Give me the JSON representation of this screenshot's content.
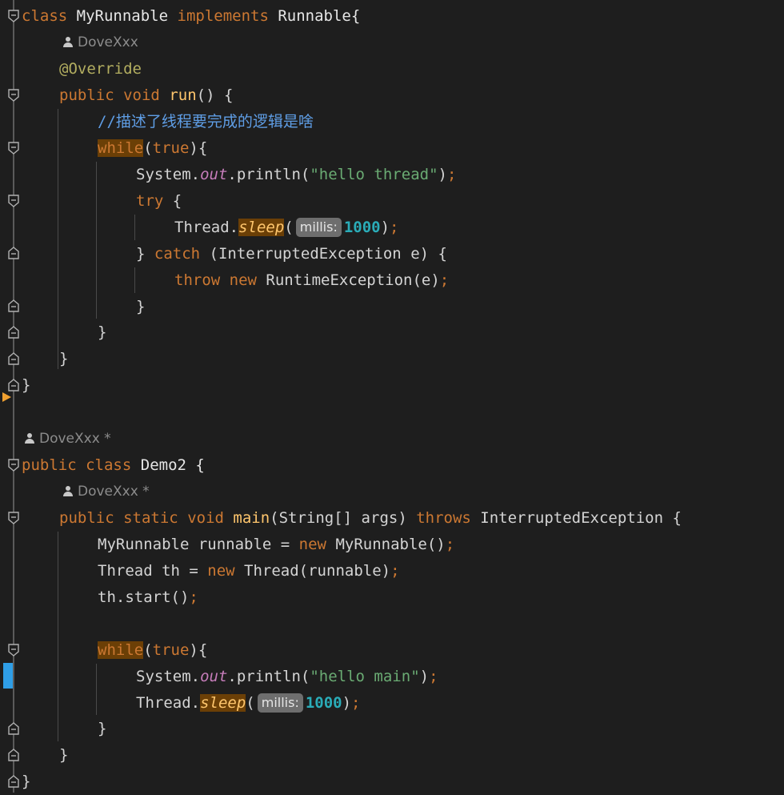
{
  "editor": {
    "author_hints": [
      {
        "name": "DoveXxx"
      },
      {
        "name": "DoveXxx *"
      },
      {
        "name": "DoveXxx *"
      }
    ],
    "lines": {
      "l1": {
        "kw_class": "class",
        "name": "MyRunnable",
        "kw_impl": "implements",
        "iface": "Runnable{"
      },
      "l3": {
        "annotation": "@Override"
      },
      "l4": {
        "kw_public": "public",
        "kw_void": "void",
        "fn": "run",
        "rest": "() {"
      },
      "l5": {
        "comment": "//描述了线程要完成的逻辑是啥"
      },
      "l6": {
        "kw_while": "while",
        "open": "(",
        "kw_true": "true",
        "close": "){"
      },
      "l7": {
        "obj": "System.",
        "field": "out",
        "call": ".println(",
        "str": "\"hello thread\"",
        "end": ")",
        "semi": ";"
      },
      "l8": {
        "kw_try": "try",
        "rest": " {"
      },
      "l9": {
        "obj": "Thread.",
        "fn": "sleep",
        "open": "(",
        "hint": "millis:",
        "num": "1000",
        "end": ")",
        "semi": ";"
      },
      "l10": {
        "pre": "} ",
        "kw_catch": "catch",
        "rest": " (InterruptedException e) {"
      },
      "l11": {
        "kw_throw": "throw",
        "kw_new": "new",
        "rest": " RuntimeException(e)",
        "semi": ";"
      },
      "l12": {
        "brace": "}"
      },
      "l13": {
        "brace": "}"
      },
      "l14": {
        "brace": "}"
      },
      "l15": {
        "brace": "}"
      },
      "l17": {
        "kw_public": "public",
        "kw_class": "class",
        "name": "Demo2 {"
      },
      "l19": {
        "kw_public": "public",
        "kw_static": "static",
        "kw_void": "void",
        "fn": "main",
        "params": "(String[] args) ",
        "kw_throws": "throws",
        "exc": " InterruptedException {"
      },
      "l20": {
        "pre": "MyRunnable runnable = ",
        "kw_new": "new",
        "rest": " MyRunnable()",
        "semi": ";"
      },
      "l21": {
        "pre": "Thread th = ",
        "kw_new": "new",
        "rest": " Thread(runnable)",
        "semi": ";"
      },
      "l22": {
        "pre": "th.start()",
        "semi": ";"
      },
      "l24": {
        "kw_while": "while",
        "open": "(",
        "kw_true": "true",
        "close": "){"
      },
      "l25": {
        "obj": "System.",
        "field": "out",
        "call": ".println(",
        "str": "\"hello main\"",
        "end": ")",
        "semi": ";"
      },
      "l26": {
        "obj": "Thread.",
        "fn": "sleep",
        "open": "(",
        "hint": "millis:",
        "num": "1000",
        "end": ")",
        "semi": ";"
      },
      "l27": {
        "brace": "}"
      },
      "l28": {
        "brace": "}"
      },
      "l29": {
        "brace": "}"
      }
    }
  }
}
